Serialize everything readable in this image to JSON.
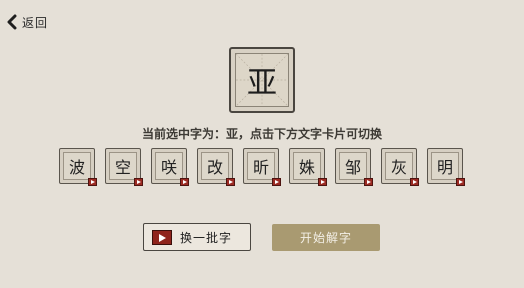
{
  "nav": {
    "back_label": "返回",
    "back_icon": "chevron-left-icon"
  },
  "current_char": "亚",
  "hint_text": "当前选中字为：亚，点击下方文字卡片可切换",
  "cards": [
    "波",
    "空",
    "咲",
    "改",
    "昕",
    "姝",
    "邹",
    "灰",
    "明"
  ],
  "buttons": {
    "swap_label": "换一批字",
    "swap_icon": "video-play-icon",
    "start_label": "开始解字"
  },
  "colors": {
    "background": "#e5e0d7",
    "start_button": "#a99a71",
    "video_badge": "#9b2a22"
  }
}
